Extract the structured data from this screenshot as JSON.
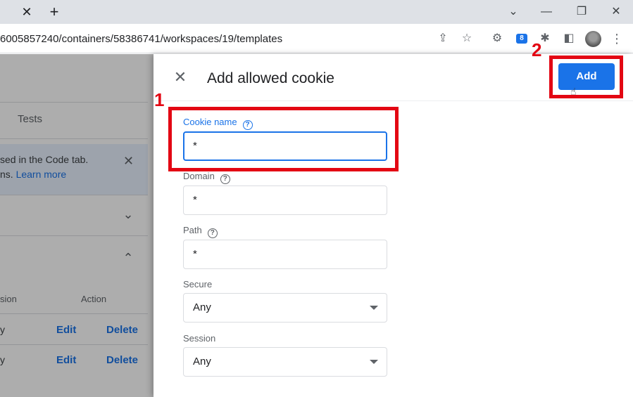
{
  "browser": {
    "url": "6005857240/containers/58386741/workspaces/19/templates",
    "icons": [
      "close-tab-icon",
      "new-tab-icon",
      "share-icon",
      "star-icon",
      "extension-icon",
      "puzzle-icon",
      "sidepanel-icon",
      "profile-avatar",
      "more-menu-icon"
    ],
    "ext_badge": "8"
  },
  "background": {
    "tab_label": "Tests",
    "notice_line1": "sed in the Code tab.",
    "notice_line2_prefix": "ns. ",
    "notice_link": "Learn more",
    "col_session": "sion",
    "col_action": "Action",
    "rows": [
      {
        "session": "y",
        "edit": "Edit",
        "delete": "Delete"
      },
      {
        "session": "y",
        "edit": "Edit",
        "delete": "Delete"
      }
    ]
  },
  "dialog": {
    "title": "Add allowed cookie",
    "add_label": "Add",
    "fields": {
      "cookie_name": {
        "label": "Cookie name",
        "value": "*"
      },
      "domain": {
        "label": "Domain",
        "value": "*"
      },
      "path": {
        "label": "Path",
        "value": "*"
      },
      "secure": {
        "label": "Secure",
        "value": "Any"
      },
      "session": {
        "label": "Session",
        "value": "Any"
      }
    }
  },
  "annotations": {
    "step1": "1",
    "step2": "2",
    "color": "#e30613"
  },
  "colors": {
    "accent": "#1a73e8",
    "highlight": "#e30613"
  }
}
